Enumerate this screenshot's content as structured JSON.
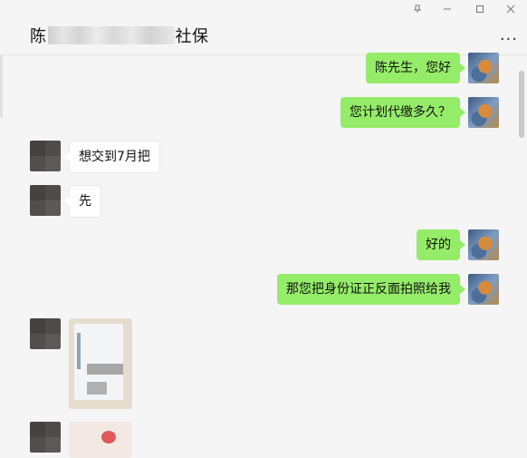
{
  "window": {
    "title_prefix": "陈",
    "title_suffix": "社保",
    "controls": {
      "pin": "⊼",
      "close": "✕",
      "minimize": "▢",
      "maximize": "□"
    },
    "more_label": "..."
  },
  "messages": [
    {
      "side": "right",
      "text": "陈先生，您好"
    },
    {
      "side": "right",
      "text": "您计划代缴多久？"
    },
    {
      "side": "left",
      "text": "想交到7月把"
    },
    {
      "side": "left",
      "text": "先"
    },
    {
      "side": "right",
      "text": "好的"
    },
    {
      "side": "right",
      "text": "那您把身份证正反面拍照给我"
    },
    {
      "side": "left",
      "type": "image"
    },
    {
      "side": "left",
      "type": "image"
    }
  ],
  "colors": {
    "self_bubble": "#95ec69",
    "other_bubble": "#ffffff",
    "background": "#f5f5f5"
  }
}
